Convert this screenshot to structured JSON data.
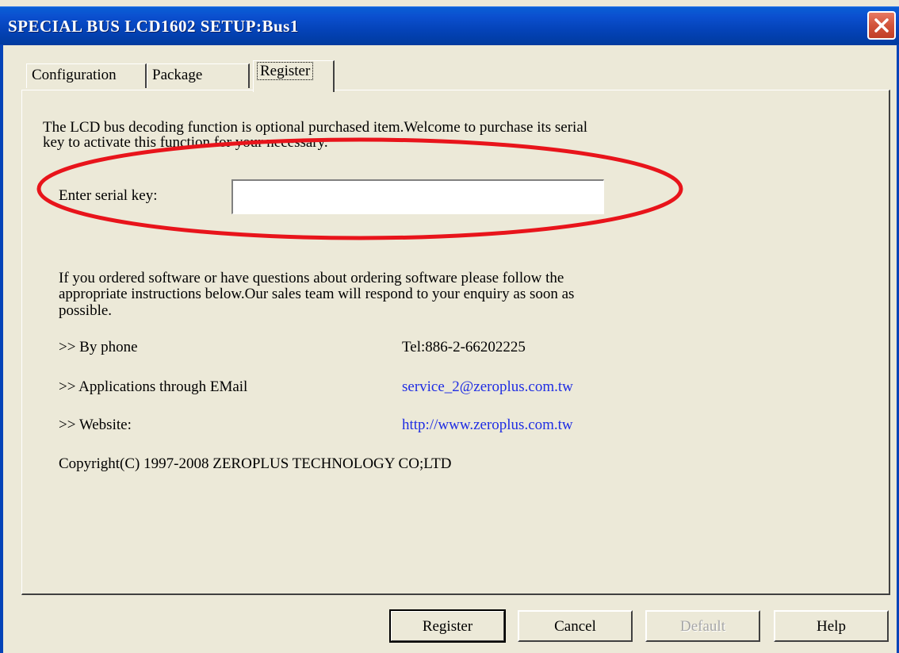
{
  "window": {
    "title": "SPECIAL BUS LCD1602 SETUP:Bus1",
    "close_icon": "close-icon"
  },
  "tabs": [
    {
      "label": "Configuration",
      "active": false
    },
    {
      "label": "Package",
      "active": false
    },
    {
      "label": "Register",
      "active": true
    }
  ],
  "register": {
    "intro_line_1": "The LCD bus decoding function is optional purchased item.Welcome to purchase its serial",
    "intro_line_2": "key to activate this function for your necessary.",
    "serial_label": "Enter serial key:",
    "serial_value": "",
    "info_line_1": "If you ordered software or have questions about ordering software please follow the",
    "info_line_2": "appropriate instructions below.Our sales team will respond to your enquiry as soon as",
    "info_line_3": "possible.",
    "phone_label": ">> By phone",
    "phone_value": "Tel:886-2-66202225",
    "email_label": ">> Applications through EMail",
    "email_value": "service_2@zeroplus.com.tw",
    "website_label": ">> Website:",
    "website_value": "http://www.zeroplus.com.tw",
    "copyright": "Copyright(C) 1997-2008 ZEROPLUS TECHNOLOGY CO;LTD"
  },
  "buttons": {
    "register": "Register",
    "cancel": "Cancel",
    "default": "Default",
    "help": "Help"
  },
  "colors": {
    "titlebar": "#0443b8",
    "link": "#1f2de3",
    "annotation": "#e8141b",
    "dialog_bg": "#ece9d8"
  }
}
